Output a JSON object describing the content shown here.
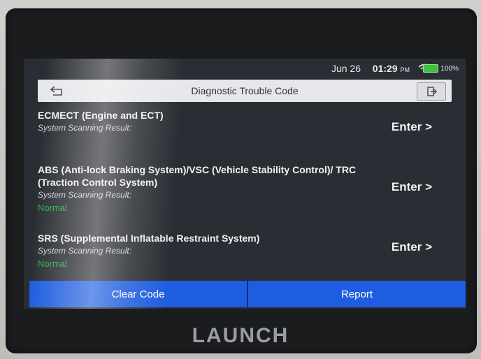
{
  "status_bar": {
    "date": "Jun 26",
    "time": "01:29",
    "ampm": "PM",
    "battery": "100%"
  },
  "header": {
    "title": "Diagnostic Trouble Code"
  },
  "systems": [
    {
      "name": "ECMECT (Engine and ECT)",
      "result_label": "System Scanning Result:",
      "result_value": "",
      "enter_label": "Enter >"
    },
    {
      "name": "ABS (Anti-lock Braking System)/VSC (Vehicle Stability Control)/ TRC (Traction Control System)",
      "result_label": "System Scanning Result:",
      "result_value": "Normal",
      "enter_label": "Enter >"
    },
    {
      "name": "SRS (Supplemental Inflatable Restraint System)",
      "result_label": "System Scanning Result:",
      "result_value": "Normal",
      "enter_label": "Enter >"
    }
  ],
  "actions": {
    "clear_code": "Clear Code",
    "report": "Report"
  },
  "brand": "LAUNCH",
  "colors": {
    "accent_blue": "#1e5de0",
    "normal_green": "#27b34a",
    "screen_bg": "#2a2d33"
  }
}
